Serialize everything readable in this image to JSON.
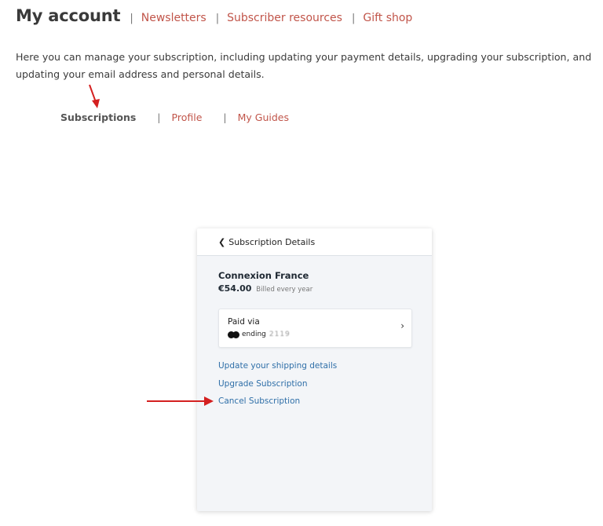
{
  "header": {
    "title": "My account",
    "separator": "|",
    "links": [
      "Newsletters",
      "Subscriber resources",
      "Gift shop"
    ]
  },
  "intro_text": "Here you can manage your subscription, including updating your payment details, upgrading your subscription, and updating your email address and personal details.",
  "sub_tabs": {
    "active": "Subscriptions",
    "separator": "|",
    "links": [
      "Profile",
      "My Guides"
    ]
  },
  "subscription_card": {
    "header_title": "Subscription Details",
    "back_icon": "chevron-left-icon",
    "plan_name": "Connexion France",
    "price": "€54.00",
    "billing": "Billed every year",
    "payment": {
      "label": "Paid via",
      "card_icon": "mastercard-icon",
      "ending_text": "ending",
      "masked_digits": "2119",
      "chevron": "chevron-right-icon"
    },
    "actions": [
      "Update your shipping details",
      "Upgrade Subscription",
      "Cancel Subscription"
    ]
  },
  "colors": {
    "link_red": "#c1554a",
    "link_blue": "#2f6fa8",
    "arrow_red": "#d42020",
    "card_bg": "#f3f5f8"
  }
}
